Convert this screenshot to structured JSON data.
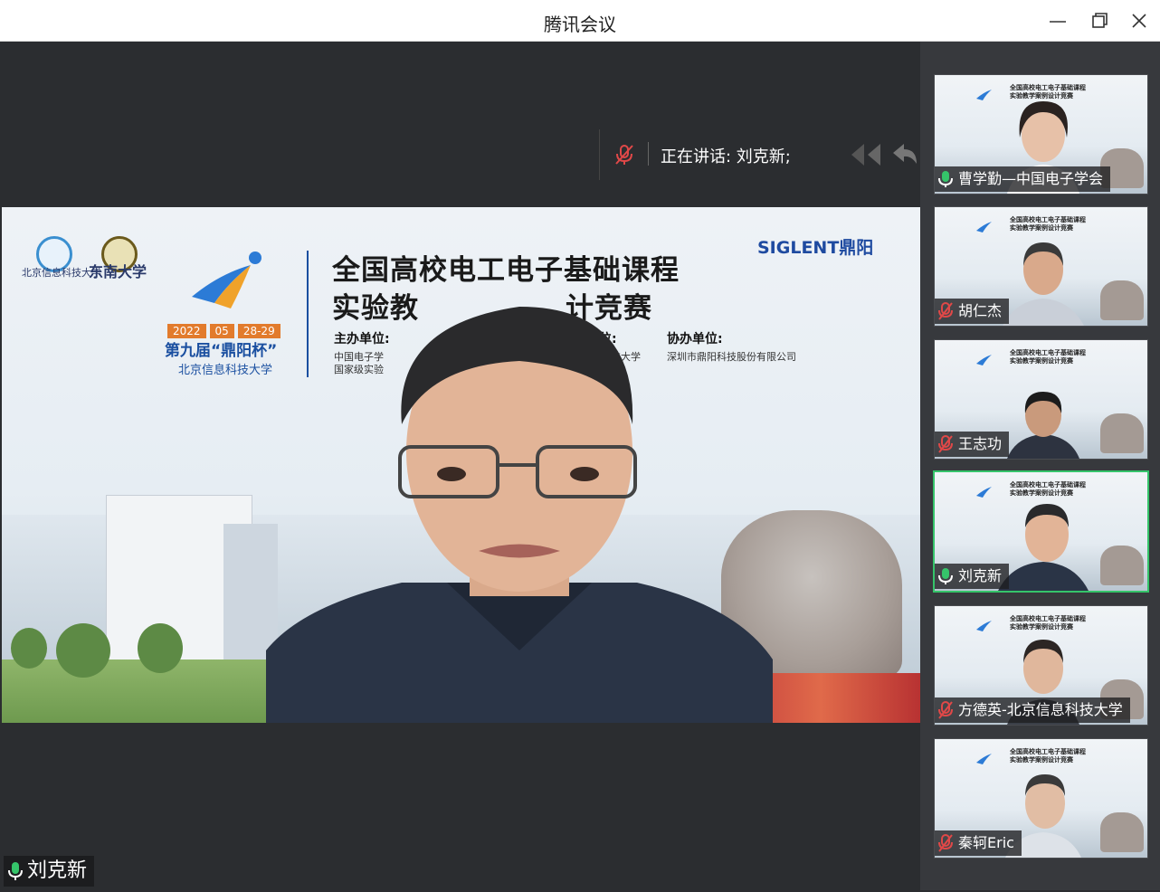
{
  "window": {
    "title": "腾讯会议"
  },
  "speaking": {
    "text": "正在讲话: 刘克新;"
  },
  "main": {
    "speaker_name": "刘克新",
    "slide": {
      "title_line1": "全国高校电工电子基础课程",
      "title_line2": "实验教",
      "title_line2_end": "计竞赛",
      "brand": "SIGLENT鼎阳",
      "date_year": "2022",
      "date_month": "05",
      "date_days": "28-29",
      "cup_name": "第九届“鼎阳杯”",
      "host_university": "北京信息科技大学",
      "label_organizer": "主办单位:",
      "organizer_1": "中国电子学",
      "organizer_2": "国家级实验",
      "label_undertaker_end": "单位:",
      "undertaker": "科技大学",
      "label_co_organizer": "协办单位:",
      "co_organizer": "深圳市鼎阳科技股份有限公司",
      "university_logo_text": "北京信息科技大学",
      "seu_text": "东南大学"
    }
  },
  "participants": [
    {
      "name": "曹学勤—中国电子学会",
      "mic": "on",
      "active": false
    },
    {
      "name": "胡仁杰",
      "mic": "muted",
      "active": false
    },
    {
      "name": "王志功",
      "mic": "muted",
      "active": false
    },
    {
      "name": "刘克新",
      "mic": "on",
      "active": true
    },
    {
      "name": "方德英-北京信息科技大学",
      "mic": "muted",
      "active": false
    },
    {
      "name": "秦轲Eric",
      "mic": "muted",
      "active": false
    }
  ],
  "tile_slide_text": {
    "line1": "全国高校电工电子基础课程",
    "line2": "实验教学案例设计竞赛"
  },
  "colors": {
    "mic_on": "#35c46a",
    "mic_muted": "#e04848",
    "active_border": "#35c46a",
    "accent_blue": "#1a4fa0",
    "date_orange": "#e27b2c"
  }
}
